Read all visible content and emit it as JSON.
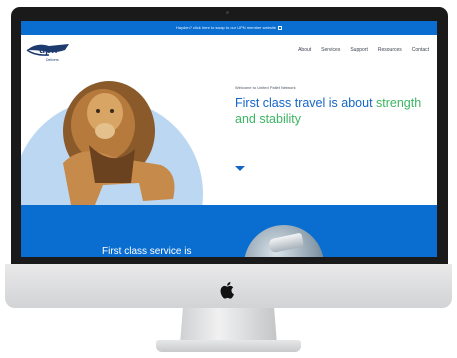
{
  "banner": {
    "text": "Hayden? click here to swap to our UPN member website"
  },
  "nav": {
    "brand_sub": "Delivers",
    "items": [
      {
        "label": "About"
      },
      {
        "label": "Services"
      },
      {
        "label": "Support"
      },
      {
        "label": "Resources"
      },
      {
        "label": "Contact"
      }
    ]
  },
  "hero": {
    "welcome": "Welcome to United Pallet Network",
    "headline_part1": "First class travel is about ",
    "headline_part2": "strength and stability"
  },
  "band": {
    "title": "First class service is"
  },
  "colors": {
    "primary_blue": "#0a6ed1",
    "accent_green": "#3db463",
    "circle": "#bcd7f2"
  }
}
